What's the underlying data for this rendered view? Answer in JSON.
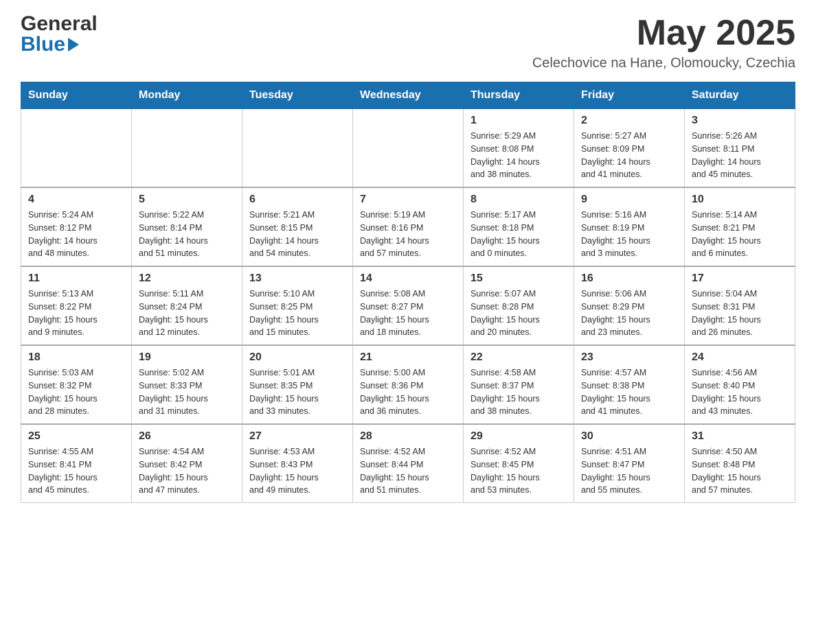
{
  "header": {
    "logo_general": "General",
    "logo_blue": "Blue",
    "month_title": "May 2025",
    "location": "Celechovice na Hane, Olomoucky, Czechia"
  },
  "weekdays": [
    "Sunday",
    "Monday",
    "Tuesday",
    "Wednesday",
    "Thursday",
    "Friday",
    "Saturday"
  ],
  "weeks": [
    {
      "days": [
        {
          "num": "",
          "info": ""
        },
        {
          "num": "",
          "info": ""
        },
        {
          "num": "",
          "info": ""
        },
        {
          "num": "",
          "info": ""
        },
        {
          "num": "1",
          "info": "Sunrise: 5:29 AM\nSunset: 8:08 PM\nDaylight: 14 hours\nand 38 minutes."
        },
        {
          "num": "2",
          "info": "Sunrise: 5:27 AM\nSunset: 8:09 PM\nDaylight: 14 hours\nand 41 minutes."
        },
        {
          "num": "3",
          "info": "Sunrise: 5:26 AM\nSunset: 8:11 PM\nDaylight: 14 hours\nand 45 minutes."
        }
      ]
    },
    {
      "days": [
        {
          "num": "4",
          "info": "Sunrise: 5:24 AM\nSunset: 8:12 PM\nDaylight: 14 hours\nand 48 minutes."
        },
        {
          "num": "5",
          "info": "Sunrise: 5:22 AM\nSunset: 8:14 PM\nDaylight: 14 hours\nand 51 minutes."
        },
        {
          "num": "6",
          "info": "Sunrise: 5:21 AM\nSunset: 8:15 PM\nDaylight: 14 hours\nand 54 minutes."
        },
        {
          "num": "7",
          "info": "Sunrise: 5:19 AM\nSunset: 8:16 PM\nDaylight: 14 hours\nand 57 minutes."
        },
        {
          "num": "8",
          "info": "Sunrise: 5:17 AM\nSunset: 8:18 PM\nDaylight: 15 hours\nand 0 minutes."
        },
        {
          "num": "9",
          "info": "Sunrise: 5:16 AM\nSunset: 8:19 PM\nDaylight: 15 hours\nand 3 minutes."
        },
        {
          "num": "10",
          "info": "Sunrise: 5:14 AM\nSunset: 8:21 PM\nDaylight: 15 hours\nand 6 minutes."
        }
      ]
    },
    {
      "days": [
        {
          "num": "11",
          "info": "Sunrise: 5:13 AM\nSunset: 8:22 PM\nDaylight: 15 hours\nand 9 minutes."
        },
        {
          "num": "12",
          "info": "Sunrise: 5:11 AM\nSunset: 8:24 PM\nDaylight: 15 hours\nand 12 minutes."
        },
        {
          "num": "13",
          "info": "Sunrise: 5:10 AM\nSunset: 8:25 PM\nDaylight: 15 hours\nand 15 minutes."
        },
        {
          "num": "14",
          "info": "Sunrise: 5:08 AM\nSunset: 8:27 PM\nDaylight: 15 hours\nand 18 minutes."
        },
        {
          "num": "15",
          "info": "Sunrise: 5:07 AM\nSunset: 8:28 PM\nDaylight: 15 hours\nand 20 minutes."
        },
        {
          "num": "16",
          "info": "Sunrise: 5:06 AM\nSunset: 8:29 PM\nDaylight: 15 hours\nand 23 minutes."
        },
        {
          "num": "17",
          "info": "Sunrise: 5:04 AM\nSunset: 8:31 PM\nDaylight: 15 hours\nand 26 minutes."
        }
      ]
    },
    {
      "days": [
        {
          "num": "18",
          "info": "Sunrise: 5:03 AM\nSunset: 8:32 PM\nDaylight: 15 hours\nand 28 minutes."
        },
        {
          "num": "19",
          "info": "Sunrise: 5:02 AM\nSunset: 8:33 PM\nDaylight: 15 hours\nand 31 minutes."
        },
        {
          "num": "20",
          "info": "Sunrise: 5:01 AM\nSunset: 8:35 PM\nDaylight: 15 hours\nand 33 minutes."
        },
        {
          "num": "21",
          "info": "Sunrise: 5:00 AM\nSunset: 8:36 PM\nDaylight: 15 hours\nand 36 minutes."
        },
        {
          "num": "22",
          "info": "Sunrise: 4:58 AM\nSunset: 8:37 PM\nDaylight: 15 hours\nand 38 minutes."
        },
        {
          "num": "23",
          "info": "Sunrise: 4:57 AM\nSunset: 8:38 PM\nDaylight: 15 hours\nand 41 minutes."
        },
        {
          "num": "24",
          "info": "Sunrise: 4:56 AM\nSunset: 8:40 PM\nDaylight: 15 hours\nand 43 minutes."
        }
      ]
    },
    {
      "days": [
        {
          "num": "25",
          "info": "Sunrise: 4:55 AM\nSunset: 8:41 PM\nDaylight: 15 hours\nand 45 minutes."
        },
        {
          "num": "26",
          "info": "Sunrise: 4:54 AM\nSunset: 8:42 PM\nDaylight: 15 hours\nand 47 minutes."
        },
        {
          "num": "27",
          "info": "Sunrise: 4:53 AM\nSunset: 8:43 PM\nDaylight: 15 hours\nand 49 minutes."
        },
        {
          "num": "28",
          "info": "Sunrise: 4:52 AM\nSunset: 8:44 PM\nDaylight: 15 hours\nand 51 minutes."
        },
        {
          "num": "29",
          "info": "Sunrise: 4:52 AM\nSunset: 8:45 PM\nDaylight: 15 hours\nand 53 minutes."
        },
        {
          "num": "30",
          "info": "Sunrise: 4:51 AM\nSunset: 8:47 PM\nDaylight: 15 hours\nand 55 minutes."
        },
        {
          "num": "31",
          "info": "Sunrise: 4:50 AM\nSunset: 8:48 PM\nDaylight: 15 hours\nand 57 minutes."
        }
      ]
    }
  ]
}
